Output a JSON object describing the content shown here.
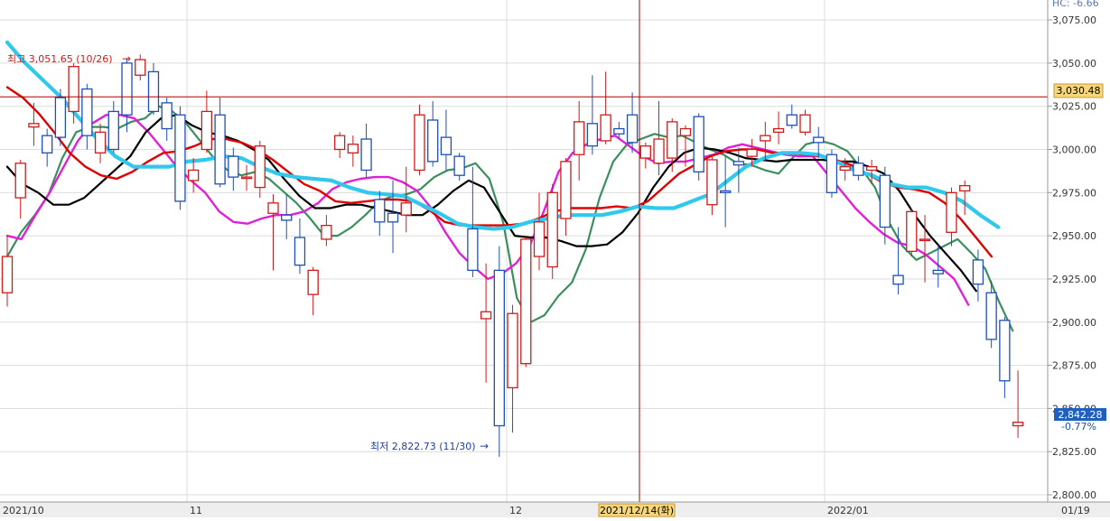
{
  "app": {
    "corner_label": "HC: -6.66",
    "crosshair": {
      "price_label": "3,030.48",
      "date_label": "2021/12/14(화)"
    },
    "current_price": {
      "label": "2,842.28",
      "change": "-0.77%"
    },
    "annotations": {
      "high": {
        "text": "최고 3,051.65 (10/26)",
        "arrow": "→"
      },
      "low": {
        "text": "최저 2,822.73 (11/30)",
        "arrow": "→"
      }
    }
  },
  "colors": {
    "up": "#d11a1a",
    "down": "#1f4fb5",
    "ma5": "#3a8f5e",
    "ma10": "#e020d8",
    "ma20": "#000000",
    "ma60": "#e00000",
    "ma120": "#30c8ec",
    "crosshair": "#b00000",
    "price_badge": "#f7d77e",
    "current_badge": "#1f5fbf",
    "grid": "#dcdcdc"
  },
  "chart_data": {
    "type": "candlestick",
    "title": "",
    "y_range": [
      2790,
      3078
    ],
    "y_ticks": [
      "3,075.00",
      "3,050.00",
      "3,025.00",
      "3,000.00",
      "2,975.00",
      "2,950.00",
      "2,925.00",
      "2,900.00",
      "2,875.00",
      "2,850.00",
      "2,825.00",
      "2,800.00"
    ],
    "x_ticks": [
      "2021/10",
      "11",
      "12",
      "2021/12/14(화)",
      "2022/01",
      "01/19"
    ],
    "candles": [
      [
        2917,
        2938,
        2909,
        2950
      ],
      [
        2972,
        2992,
        2960,
        2994
      ],
      [
        3013,
        3015,
        3002,
        3027
      ],
      [
        3008,
        2998,
        2990,
        3012
      ],
      [
        3030,
        3007,
        3002,
        3035
      ],
      [
        3022,
        3048,
        3015,
        3050
      ],
      [
        3035,
        3008,
        3000,
        3038
      ],
      [
        2998,
        3010,
        2992,
        3015
      ],
      [
        3022,
        3000,
        2998,
        3028
      ],
      [
        3050,
        3020,
        3010,
        3053
      ],
      [
        3043,
        3052,
        3040,
        3055
      ],
      [
        3045,
        3022,
        3020,
        3050
      ],
      [
        3027,
        3012,
        3005,
        3030
      ],
      [
        3020,
        2970,
        2965,
        3025
      ],
      [
        2982,
        2988,
        2975,
        2995
      ],
      [
        3000,
        3022,
        2998,
        3034
      ],
      [
        3020,
        2980,
        2978,
        3030
      ],
      [
        2996,
        2984,
        2976,
        3001
      ],
      [
        2984,
        2984,
        2976,
        2991
      ],
      [
        2978,
        3002,
        2972,
        3005
      ],
      [
        2963,
        2969,
        2930,
        2974
      ],
      [
        2962,
        2959,
        2948,
        2974
      ],
      [
        2949,
        2933,
        2928,
        2960
      ],
      [
        2916,
        2930,
        2904,
        2932
      ],
      [
        2948,
        2956,
        2944,
        2962
      ],
      [
        3000,
        3008,
        2995,
        3010
      ],
      [
        2998,
        3003,
        2990,
        3008
      ],
      [
        3006,
        2988,
        2984,
        3015
      ],
      [
        2971,
        2958,
        2950,
        2976
      ],
      [
        2963,
        2958,
        2940,
        2982
      ],
      [
        2962,
        2969,
        2952,
        2990
      ],
      [
        2988,
        3020,
        2985,
        3026
      ],
      [
        3017,
        2993,
        2990,
        3028
      ],
      [
        3007,
        2997,
        2988,
        3023
      ],
      [
        2996,
        2985,
        2982,
        2998
      ],
      [
        2954,
        2930,
        2926,
        2990
      ],
      [
        2902,
        2906,
        2865,
        2934
      ],
      [
        2930,
        2840,
        2822,
        2944
      ],
      [
        2862,
        2905,
        2836,
        2910
      ],
      [
        2876,
        2948,
        2874,
        2949
      ],
      [
        2938,
        2958,
        2930,
        2975
      ],
      [
        2932,
        2975,
        2925,
        2980
      ],
      [
        2960,
        2993,
        2950,
        2995
      ],
      [
        2997,
        3016,
        2982,
        3028
      ],
      [
        3015,
        3002,
        2997,
        3043
      ],
      [
        3005,
        3020,
        3003,
        3045
      ],
      [
        3012,
        3009,
        3006,
        3016
      ],
      [
        3020,
        3004,
        2998,
        3033
      ],
      [
        2995,
        3002,
        2989,
        3004
      ],
      [
        2992,
        3006,
        2985,
        3028
      ],
      [
        2995,
        3016,
        2987,
        3018
      ],
      [
        3008,
        3012,
        2990,
        3014
      ],
      [
        3019,
        2987,
        2982,
        3021
      ],
      [
        2968,
        2994,
        2962,
        2996
      ],
      [
        2976,
        2975,
        2955,
        2996
      ],
      [
        2993,
        2991,
        2975,
        3001
      ],
      [
        2996,
        3000,
        2990,
        3006
      ],
      [
        3005,
        3008,
        2993,
        3016
      ],
      [
        3010,
        3012,
        3003,
        3022
      ],
      [
        3020,
        3014,
        3012,
        3026
      ],
      [
        3010,
        3020,
        3008,
        3023
      ],
      [
        3007,
        3004,
        2995,
        3013
      ],
      [
        2997,
        2975,
        2972,
        3000
      ],
      [
        2988,
        2990,
        2982,
        2995
      ],
      [
        2992,
        2985,
        2982,
        2996
      ],
      [
        2988,
        2990,
        2980,
        2994
      ],
      [
        2985,
        2955,
        2945,
        2990
      ],
      [
        2927,
        2922,
        2916,
        2955
      ],
      [
        2941,
        2964,
        2938,
        2966
      ],
      [
        2948,
        2948,
        2923,
        2962
      ],
      [
        2930,
        2928,
        2920,
        2945
      ],
      [
        2952,
        2975,
        2944,
        2978
      ],
      [
        2976,
        2979,
        2962,
        2982
      ],
      [
        2936,
        2922,
        2912,
        2942
      ],
      [
        2917,
        2890,
        2885,
        2924
      ],
      [
        2901,
        2866,
        2856,
        2903
      ],
      [
        2840,
        2842,
        2833,
        2872
      ]
    ],
    "series": [
      {
        "name": "MA5",
        "values": [
          2938,
          2952,
          2962,
          2974,
          2995,
          3010,
          3013,
          3013,
          3012,
          3016,
          3018,
          3025,
          3022,
          3015,
          3005,
          2995,
          2988,
          2985,
          2987,
          2983,
          2976,
          2969,
          2960,
          2950,
          2950,
          2955,
          2962,
          2970,
          2973,
          2974,
          2977,
          2984,
          2988,
          2989,
          2992,
          2983,
          2958,
          2914,
          2900,
          2904,
          2915,
          2923,
          2942,
          2972,
          2993,
          3003,
          3006,
          3009,
          3007,
          3008,
          3004,
          3000,
          2997,
          2992,
          2991,
          2988,
          2986,
          2995,
          3003,
          3005,
          3003,
          2999,
          2989,
          2978,
          2958,
          2944,
          2936,
          2940,
          2944,
          2948,
          2940,
          2931,
          2912,
          2895
        ]
      },
      {
        "name": "MA10",
        "values": [
          2950,
          2948,
          2962,
          2975,
          2990,
          3005,
          3015,
          3020,
          3020,
          3018,
          3010,
          3000,
          2990,
          2982,
          2975,
          2964,
          2958,
          2957,
          2960,
          2962,
          2962,
          2964,
          2969,
          2977,
          2981,
          2983,
          2984,
          2984,
          2981,
          2976,
          2966,
          2952,
          2940,
          2932,
          2925,
          2928,
          2934,
          2945,
          2965,
          2987,
          2998,
          3003,
          3006,
          3008,
          3002,
          2996,
          2992,
          2993,
          2993,
          2995,
          2997,
          3001,
          3003,
          3001,
          2999,
          2997,
          2996,
          2996,
          2986,
          2976,
          2966,
          2958,
          2951,
          2946,
          2944,
          2939,
          2932,
          2925,
          2910
        ]
      },
      {
        "name": "MA20",
        "values": [
          2990,
          2980,
          2975,
          2968,
          2968,
          2972,
          2980,
          2988,
          2996,
          3010,
          3018,
          3020,
          3014,
          3010,
          3008,
          3005,
          3000,
          2994,
          2983,
          2973,
          2966,
          2966,
          2968,
          2968,
          2966,
          2964,
          2962,
          2962,
          2968,
          2976,
          2982,
          2978,
          2964,
          2950,
          2949,
          2949,
          2947,
          2944,
          2944,
          2945,
          2952,
          2963,
          2978,
          2990,
          2998,
          3001,
          3000,
          2998,
          2995,
          2994,
          2993,
          2994,
          2994,
          2994,
          2993,
          2993,
          2990,
          2986,
          2976,
          2962,
          2950,
          2940,
          2930,
          2918
        ]
      },
      {
        "name": "MA60",
        "values": [
          3036,
          3030,
          3021,
          3010,
          2998,
          2990,
          2985,
          2983,
          2987,
          2993,
          2998,
          2999,
          3002,
          3006,
          3006,
          3004,
          3000,
          2994,
          2987,
          2980,
          2976,
          2970,
          2969,
          2970,
          2971,
          2971,
          2970,
          2965,
          2958,
          2956,
          2956,
          2956,
          2956,
          2957,
          2960,
          2964,
          2966,
          2966,
          2966,
          2967,
          2966,
          2970,
          2978,
          2986,
          2991,
          2996,
          2999,
          3000,
          3000,
          2998,
          2998,
          2997,
          2996,
          2994,
          2991,
          2986,
          2981,
          2978,
          2977,
          2975,
          2969,
          2960,
          2949,
          2938
        ]
      },
      {
        "name": "MA120",
        "values": [
          3062,
          3050,
          3040,
          3030,
          3018,
          3006,
          2996,
          2990,
          2990,
          2990,
          2993,
          2994,
          2996,
          2995,
          2990,
          2986,
          2984,
          2983,
          2982,
          2978,
          2975,
          2974,
          2973,
          2968,
          2963,
          2957,
          2955,
          2954,
          2955,
          2958,
          2960,
          2962,
          2962,
          2962,
          2964,
          2967,
          2966,
          2966,
          2970,
          2974,
          2982,
          2990,
          2995,
          2998,
          2998,
          2997,
          2993,
          2988,
          2985,
          2980,
          2978,
          2978,
          2975,
          2970,
          2962,
          2955
        ]
      }
    ]
  }
}
